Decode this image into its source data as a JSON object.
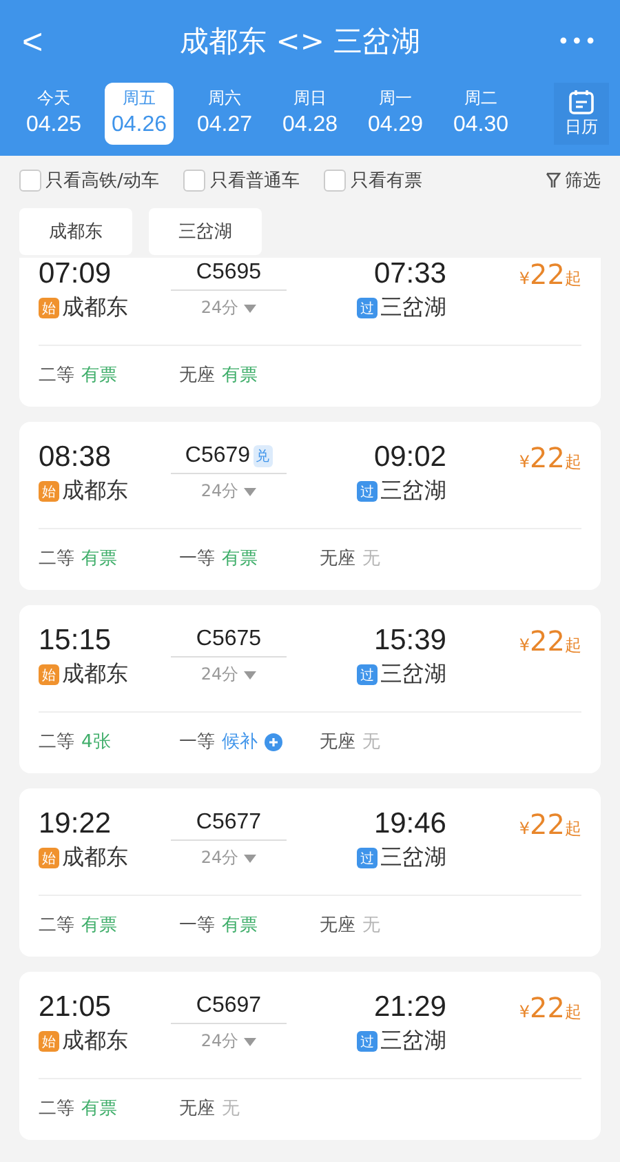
{
  "header": {
    "back": "<",
    "title": "成都东 <> 三岔湖",
    "more": "•••"
  },
  "dates": [
    {
      "weekday": "今天",
      "date": "04.25",
      "selected": false
    },
    {
      "weekday": "周五",
      "date": "04.26",
      "selected": true
    },
    {
      "weekday": "周六",
      "date": "04.27",
      "selected": false
    },
    {
      "weekday": "周日",
      "date": "04.28",
      "selected": false
    },
    {
      "weekday": "周一",
      "date": "04.29",
      "selected": false
    },
    {
      "weekday": "周二",
      "date": "04.30",
      "selected": false
    }
  ],
  "calendar": {
    "label": "日历"
  },
  "filters": [
    {
      "label": "只看高铁/动车",
      "checked": false
    },
    {
      "label": "只看普通车",
      "checked": false
    },
    {
      "label": "只看有票",
      "checked": false
    }
  ],
  "filter_button": "筛选",
  "stations": [
    "成都东",
    "三岔湖"
  ],
  "trains": [
    {
      "dep_time": "07:09",
      "train": "C5695",
      "arr_time": "07:33",
      "dep_tag": {
        "text": "始",
        "color": "#f0922e"
      },
      "dep_station": "成都东",
      "duration": "24分",
      "arr_tag": {
        "text": "过",
        "color": "#3f94ea"
      },
      "arr_station": "三岔湖",
      "price_sign": "¥",
      "price": "22",
      "price_suffix": "起",
      "seats": [
        {
          "class": "二等",
          "status": "有票",
          "kind": "available"
        },
        {
          "class": "无座",
          "status": "有票",
          "kind": "available"
        }
      ]
    },
    {
      "dep_time": "08:38",
      "train": "C5679",
      "badge": "兑",
      "arr_time": "09:02",
      "dep_tag": {
        "text": "始",
        "color": "#f0922e"
      },
      "dep_station": "成都东",
      "duration": "24分",
      "arr_tag": {
        "text": "过",
        "color": "#3f94ea"
      },
      "arr_station": "三岔湖",
      "price_sign": "¥",
      "price": "22",
      "price_suffix": "起",
      "seats": [
        {
          "class": "二等",
          "status": "有票",
          "kind": "available"
        },
        {
          "class": "一等",
          "status": "有票",
          "kind": "available"
        },
        {
          "class": "无座",
          "status": "无",
          "kind": "none"
        }
      ]
    },
    {
      "dep_time": "15:15",
      "train": "C5675",
      "arr_time": "15:39",
      "dep_tag": {
        "text": "始",
        "color": "#f0922e"
      },
      "dep_station": "成都东",
      "duration": "24分",
      "arr_tag": {
        "text": "过",
        "color": "#3f94ea"
      },
      "arr_station": "三岔湖",
      "price_sign": "¥",
      "price": "22",
      "price_suffix": "起",
      "seats": [
        {
          "class": "二等",
          "status": "4张",
          "kind": "available"
        },
        {
          "class": "一等",
          "status": "候补",
          "kind": "waitlist"
        },
        {
          "class": "无座",
          "status": "无",
          "kind": "none"
        }
      ]
    },
    {
      "dep_time": "19:22",
      "train": "C5677",
      "arr_time": "19:46",
      "dep_tag": {
        "text": "始",
        "color": "#f0922e"
      },
      "dep_station": "成都东",
      "duration": "24分",
      "arr_tag": {
        "text": "过",
        "color": "#3f94ea"
      },
      "arr_station": "三岔湖",
      "price_sign": "¥",
      "price": "22",
      "price_suffix": "起",
      "seats": [
        {
          "class": "二等",
          "status": "有票",
          "kind": "available"
        },
        {
          "class": "一等",
          "status": "有票",
          "kind": "available"
        },
        {
          "class": "无座",
          "status": "无",
          "kind": "none"
        }
      ]
    },
    {
      "dep_time": "21:05",
      "train": "C5697",
      "arr_time": "21:29",
      "dep_tag": {
        "text": "始",
        "color": "#f0922e"
      },
      "dep_station": "成都东",
      "duration": "24分",
      "arr_tag": {
        "text": "过",
        "color": "#3f94ea"
      },
      "arr_station": "三岔湖",
      "price_sign": "¥",
      "price": "22",
      "price_suffix": "起",
      "seats": [
        {
          "class": "二等",
          "status": "有票",
          "kind": "available"
        },
        {
          "class": "无座",
          "status": "无",
          "kind": "none"
        }
      ]
    }
  ]
}
